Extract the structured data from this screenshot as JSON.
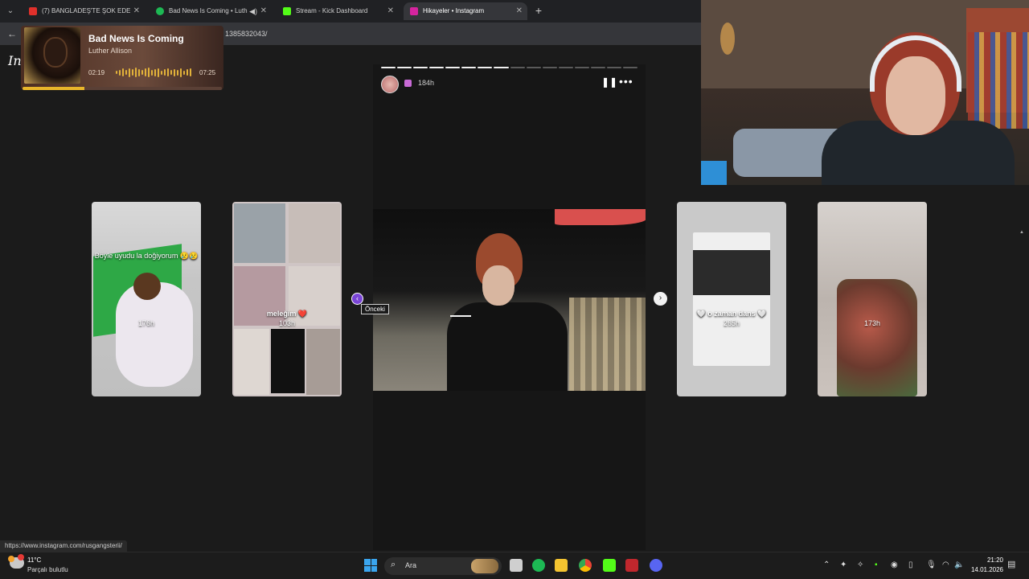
{
  "browser": {
    "tabs": [
      {
        "label": "(7) BANGLADEŞ'TE ŞOK EDEN",
        "color": "#e0302b"
      },
      {
        "label": "Bad News Is Coming • Luth",
        "color": "#1db954"
      },
      {
        "label": "Stream - Kick Dashboard",
        "color": "#53fc18"
      },
      {
        "label": "Hikayeler • Instagram",
        "color": "#d6249f"
      }
    ],
    "url_partial": "1385832043/",
    "status_url": "https://www.instagram.com/rusgangsterii/"
  },
  "now_playing": {
    "title": "Bad News Is Coming",
    "artist": "Luther Allison",
    "current": "02:19",
    "total": "07:25",
    "progress_fraction": 0.31
  },
  "instagram": {
    "logo_partial": "In",
    "stories": [
      {
        "time": "176h",
        "caption": "Böyle uyudu la doğiyorum 😢😢"
      },
      {
        "time": "103h",
        "caption": "meleğim ❤️"
      },
      {
        "time": "184h",
        "caption": ""
      },
      {
        "time": "265h",
        "caption": "🤍 o zaman dans 🤍"
      },
      {
        "time": "173h",
        "caption": ""
      }
    ],
    "progress_segments": 16,
    "progress_done": 8,
    "tooltip": "Önceki"
  },
  "taskbar": {
    "temperature": "11°C",
    "condition": "Parçalı bulutlu",
    "search": "Ara",
    "time": "21:20",
    "date": "14.01.2026"
  }
}
